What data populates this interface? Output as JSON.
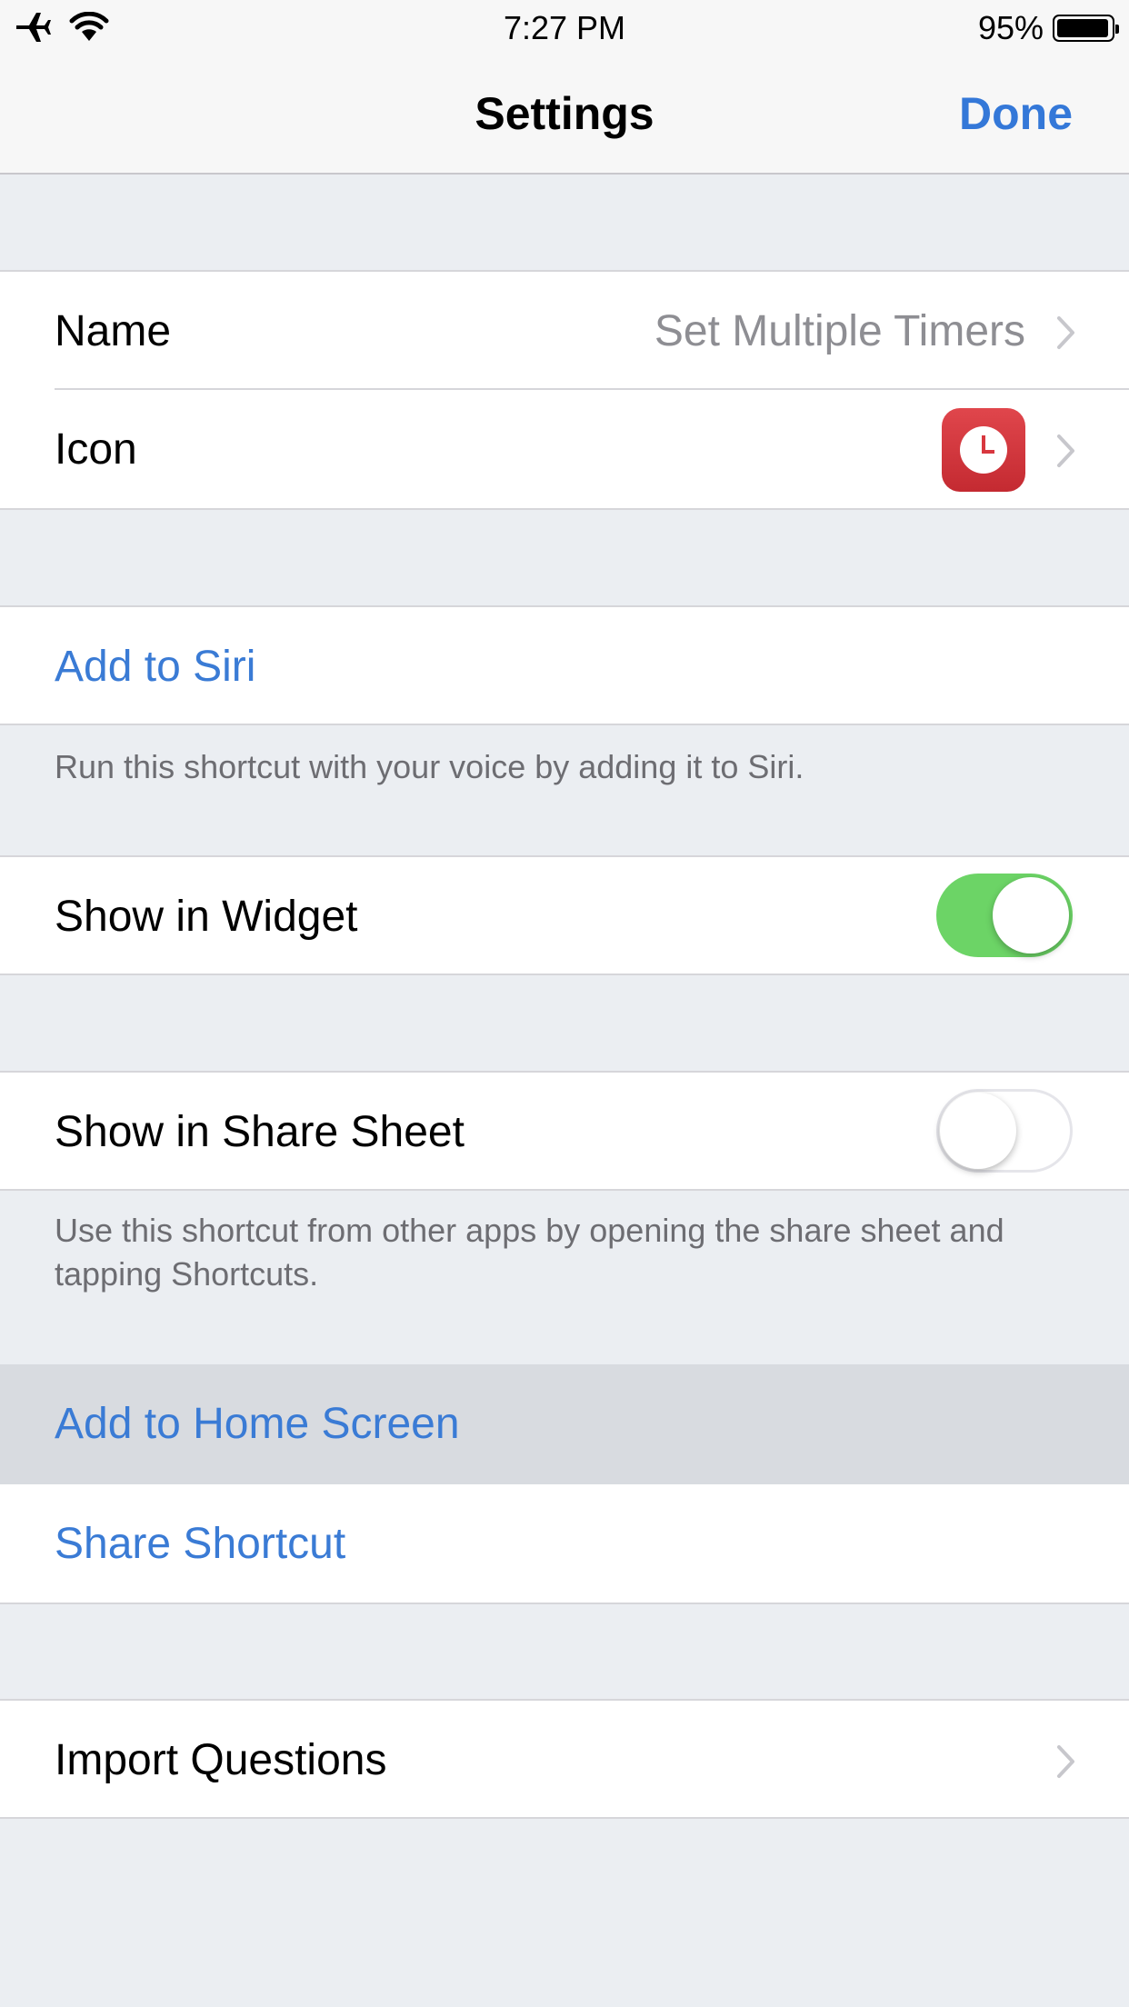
{
  "status_bar": {
    "time": "7:27 PM",
    "battery_percent": "95%",
    "icons": [
      "airplane-icon",
      "wifi-icon",
      "battery-icon"
    ]
  },
  "nav": {
    "title": "Settings",
    "done_label": "Done"
  },
  "rows": {
    "name": {
      "label": "Name",
      "value": "Set Multiple Timers"
    },
    "icon": {
      "label": "Icon",
      "icon_name": "clock-icon",
      "icon_color": "#d8373f"
    },
    "add_to_siri": {
      "label": "Add to Siri"
    },
    "show_in_widget": {
      "label": "Show in Widget",
      "enabled": true
    },
    "show_in_share_sheet": {
      "label": "Show in Share Sheet",
      "enabled": false
    },
    "add_to_home_screen": {
      "label": "Add to Home Screen"
    },
    "share_shortcut": {
      "label": "Share Shortcut"
    },
    "import_questions": {
      "label": "Import Questions"
    }
  },
  "footers": {
    "siri": "Run this shortcut with your voice by adding it to Siri.",
    "share_sheet": "Use this shortcut from other apps by opening the share sheet and tapping Shortcuts."
  },
  "colors": {
    "accent": "#3a7bd5",
    "toggle_on": "#6cd466",
    "group_background": "#ebeef2",
    "highlighted_row": "#d8dbe0"
  }
}
